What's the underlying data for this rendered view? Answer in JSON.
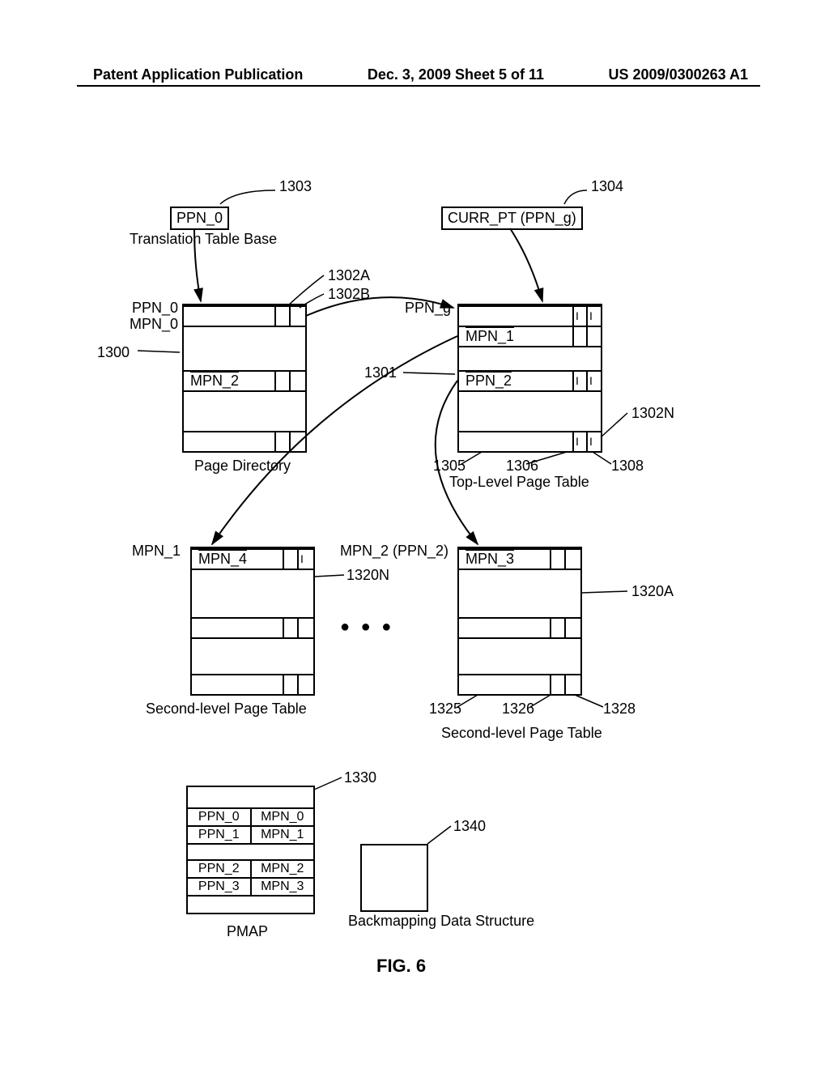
{
  "header": {
    "left": "Patent Application Publication",
    "mid": "Dec. 3, 2009  Sheet 5 of 11",
    "right": "US 2009/0300263 A1"
  },
  "figure_label": "FIG. 6",
  "chart_data": {
    "type": "diagram",
    "title": "FIG. 6",
    "blocks": [
      {
        "id": "1303",
        "label": "PPN_0",
        "sub_label": "Translation Table Base"
      },
      {
        "id": "1304",
        "label": "CURR_PT (PPN_g)"
      },
      {
        "id": "1300",
        "kind": "Page Directory",
        "header_left": "PPN_0",
        "header_left2": "MPN_0",
        "rows": [
          "MPN_2"
        ],
        "id_cols": [
          "1302A",
          "1302B"
        ]
      },
      {
        "id": "1301",
        "kind": "Top-Level Page Table",
        "header_left": "PPN_g",
        "rows": [
          "MPN_1",
          "PPN_2"
        ],
        "id_cols": [
          "I",
          "I"
        ],
        "notes": [
          "1302N",
          "1305",
          "1306",
          "1308"
        ]
      },
      {
        "id": "1320N",
        "kind": "Second-level Page Table",
        "header_left": "MPN_1",
        "rows": [
          "MPN_4"
        ],
        "flags": [
          "I"
        ]
      },
      {
        "id": "1320A",
        "kind": "Second-level Page Table",
        "header_left": "MPN_2 (PPN_2)",
        "rows": [
          "MPN_3"
        ],
        "notes": [
          "1325",
          "1326",
          "1328"
        ]
      },
      {
        "id": "1330",
        "kind": "PMAP",
        "pairs": [
          [
            "PPN_0",
            "MPN_0"
          ],
          [
            "PPN_1",
            "MPN_1"
          ],
          [
            "PPN_2",
            "MPN_2"
          ],
          [
            "PPN_3",
            "MPN_3"
          ]
        ]
      },
      {
        "id": "1340",
        "kind": "Backmapping Data Structure"
      }
    ],
    "labels": {
      "translation_table_base": "Translation Table Base",
      "page_directory": "Page Directory",
      "top_level_page_table": "Top-Level Page Table",
      "second_level_page_table": "Second-level Page Table",
      "pmap": "PMAP",
      "backmapping": "Backmapping Data Structure",
      "ellipsis": "●   ●   ●"
    },
    "refs": {
      "r1303": "1303",
      "r1304": "1304",
      "r1302A": "1302A",
      "r1302B": "1302B",
      "r1300": "1300",
      "r1301": "1301",
      "r1302N": "1302N",
      "r1305": "1305",
      "r1306": "1306",
      "r1308": "1308",
      "r1320N": "1320N",
      "r1320A": "1320A",
      "r1325": "1325",
      "r1326": "1326",
      "r1328": "1328",
      "r1330": "1330",
      "r1340": "1340"
    },
    "values": {
      "PPN_0": "PPN_0",
      "MPN_0": "MPN_0",
      "MPN_1": "MPN_1",
      "MPN_2": "MPN_2",
      "MPN_3": "MPN_3",
      "MPN_4": "MPN_4",
      "PPN_1": "PPN_1",
      "PPN_2": "PPN_2",
      "PPN_3": "PPN_3",
      "PPN_g": "PPN_g",
      "CURR_PT": "CURR_PT (PPN_g)",
      "I": "I",
      "MPN_2_PPN_2": "MPN_2 (PPN_2)"
    }
  }
}
